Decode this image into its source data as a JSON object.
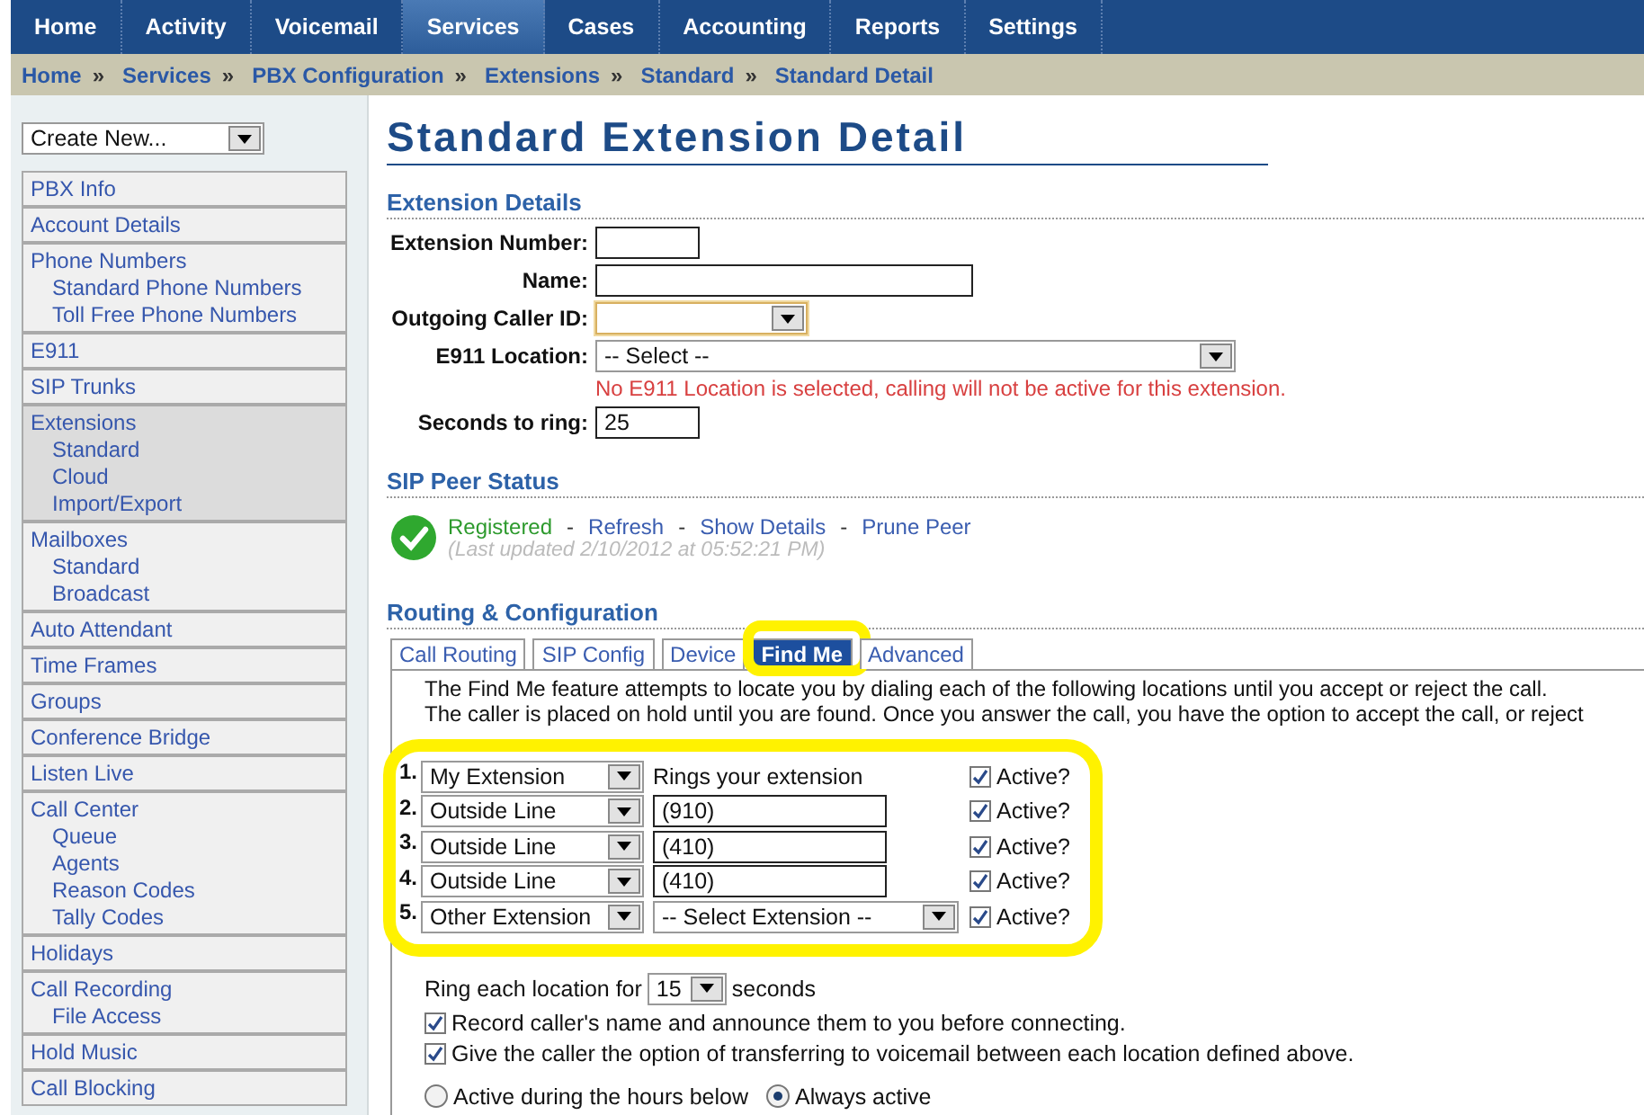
{
  "nav": [
    {
      "label": "Home",
      "selected": false
    },
    {
      "label": "Activity",
      "selected": false
    },
    {
      "label": "Voicemail",
      "selected": false
    },
    {
      "label": "Services",
      "selected": true
    },
    {
      "label": "Cases",
      "selected": false
    },
    {
      "label": "Accounting",
      "selected": false
    },
    {
      "label": "Reports",
      "selected": false
    },
    {
      "label": "Settings",
      "selected": false
    }
  ],
  "breadcrumb": {
    "separator": "»",
    "items": [
      "Home",
      "Services",
      "PBX Configuration",
      "Extensions",
      "Standard",
      "Standard Detail"
    ]
  },
  "sidebar": {
    "create_new": "Create New...",
    "groups": [
      {
        "label": "PBX Info",
        "selected": false
      },
      {
        "label": "Account Details",
        "selected": false
      },
      {
        "label": "Phone Numbers",
        "selected": false,
        "children": [
          "Standard Phone Numbers",
          "Toll Free Phone Numbers"
        ]
      },
      {
        "label": "E911",
        "selected": false
      },
      {
        "label": "SIP Trunks",
        "selected": false
      },
      {
        "label": "Extensions",
        "selected": true,
        "children": [
          "Standard",
          "Cloud",
          "Import/Export"
        ]
      },
      {
        "label": "Mailboxes",
        "selected": false,
        "children": [
          "Standard",
          "Broadcast"
        ]
      },
      {
        "label": "Auto Attendant",
        "selected": false
      },
      {
        "label": "Time Frames",
        "selected": false
      },
      {
        "label": "Groups",
        "selected": false
      },
      {
        "label": "Conference Bridge",
        "selected": false
      },
      {
        "label": "Listen Live",
        "selected": false
      },
      {
        "label": "Call Center",
        "selected": false,
        "children": [
          "Queue",
          "Agents",
          "Reason Codes",
          "Tally Codes"
        ]
      },
      {
        "label": "Holidays",
        "selected": false
      },
      {
        "label": "Call Recording",
        "selected": false,
        "children": [
          "File Access"
        ]
      },
      {
        "label": "Hold Music",
        "selected": false
      },
      {
        "label": "Call Blocking",
        "selected": false
      }
    ]
  },
  "page_title": "Standard Extension Detail",
  "extension_details": {
    "heading": "Extension Details",
    "fields": [
      {
        "label": "Extension Number:",
        "kind": "text"
      },
      {
        "label": "Name:",
        "kind": "text"
      },
      {
        "label": "Outgoing Caller ID:",
        "kind": "select",
        "focused": true
      },
      {
        "label": "E911 Location:",
        "kind": "select",
        "focused": false,
        "value": "-- Select --",
        "error": "No E911 Location is selected, calling will not be active for this extension."
      },
      {
        "label": "Seconds to ring:",
        "kind": "text",
        "value": "25"
      }
    ]
  },
  "sip_peer": {
    "heading": "SIP Peer Status",
    "status": "Registered",
    "links": [
      "Refresh",
      "Show Details",
      "Prune Peer"
    ],
    "separator": "-",
    "last_updated": "(Last updated 2/10/2012 at 05:52:21 PM)"
  },
  "routing": {
    "heading": "Routing & Configuration",
    "tabs": [
      {
        "label": "Call Routing",
        "selected": false
      },
      {
        "label": "SIP Config",
        "selected": false
      },
      {
        "label": "Device",
        "selected": false
      },
      {
        "label": "Find Me",
        "selected": true
      },
      {
        "label": "Advanced",
        "selected": false
      }
    ],
    "description": [
      "The Find Me feature attempts to locate you by dialing each of the following locations until you accept or reject the call.",
      "The caller is placed on hold until you are found. Once you answer the call, you have the option to accept the call, or reject"
    ],
    "find_me": [
      {
        "number": "1.",
        "type": "My Extension",
        "kind": "note",
        "target": "Rings your extension",
        "active_label": "Active?",
        "checked": true
      },
      {
        "number": "2.",
        "type": "Outside Line",
        "kind": "input",
        "target": "(910)",
        "active_label": "Active?",
        "checked": true
      },
      {
        "number": "3.",
        "type": "Outside Line",
        "kind": "input",
        "target": "(410)",
        "active_label": "Active?",
        "checked": true
      },
      {
        "number": "4.",
        "type": "Outside Line",
        "kind": "input",
        "target": "(410)",
        "active_label": "Active?",
        "checked": true
      },
      {
        "number": "5.",
        "type": "Other Extension",
        "kind": "select",
        "target": "-- Select Extension --",
        "active_label": "Active?",
        "checked": true
      }
    ],
    "ring_each": {
      "label": "Ring each location for",
      "value": "15",
      "suffix": "seconds"
    },
    "options": [
      {
        "label": "Record caller's name and announce them to you before connecting.",
        "checked": true
      },
      {
        "label": "Give the caller the option of transferring to voicemail between each location defined above.",
        "checked": true
      }
    ],
    "schedule": [
      {
        "label": "Active during the hours below",
        "selected": false
      },
      {
        "label": "Always active",
        "selected": true
      }
    ]
  }
}
